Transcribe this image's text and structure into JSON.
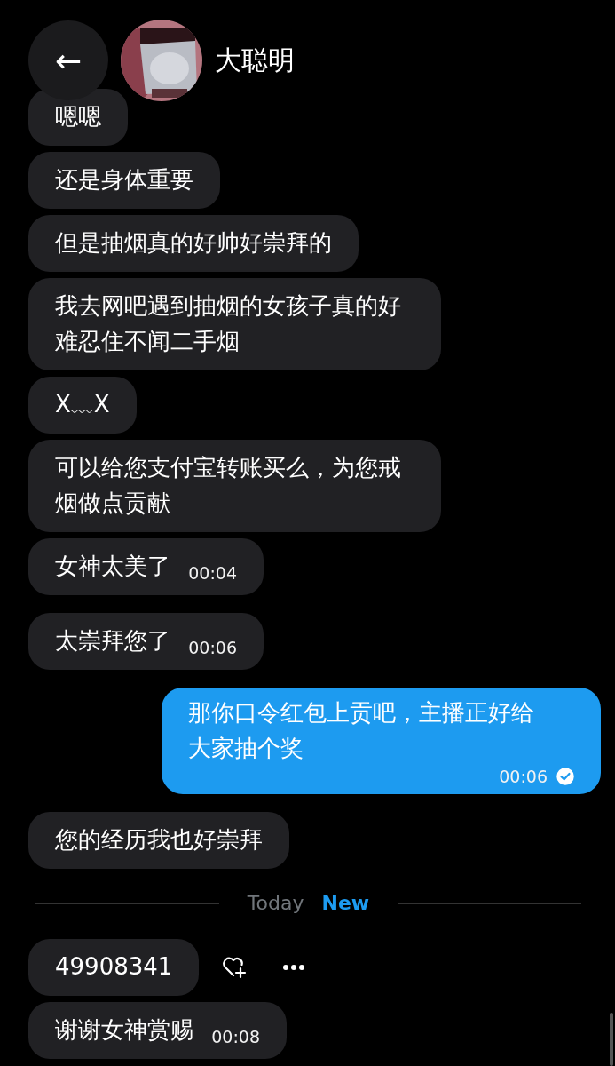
{
  "header": {
    "back": "←",
    "name": "大聪明"
  },
  "messages": [
    {
      "kind": "incoming",
      "text": "嗯嗯"
    },
    {
      "kind": "incoming",
      "text": "还是身体重要"
    },
    {
      "kind": "incoming",
      "text": "但是抽烟真的好帅好崇拜的"
    },
    {
      "kind": "incoming",
      "text": "我去网吧遇到抽烟的女孩子真的好难忍住不闻二手烟"
    },
    {
      "kind": "incoming",
      "text": "X﹏X"
    },
    {
      "kind": "incoming",
      "text": "可以给您支付宝转账买么，为您戒烟做点贡献"
    },
    {
      "kind": "incoming",
      "text": "女神太美了",
      "time": "00:04"
    },
    {
      "kind": "incoming",
      "text": "太崇拜您了",
      "time": "00:06"
    },
    {
      "kind": "outgoing",
      "text": "那你口令红包上贡吧，主播正好给大家抽个奖",
      "time": "00:06",
      "read": true
    },
    {
      "kind": "incoming",
      "text": "您的经历我也好崇拜"
    },
    {
      "kind": "separator",
      "date": "Today",
      "badge": "New"
    },
    {
      "kind": "incoming",
      "text": "49908341",
      "actions": true
    },
    {
      "kind": "incoming",
      "text": "谢谢女神赏赐",
      "time": "00:08"
    }
  ]
}
